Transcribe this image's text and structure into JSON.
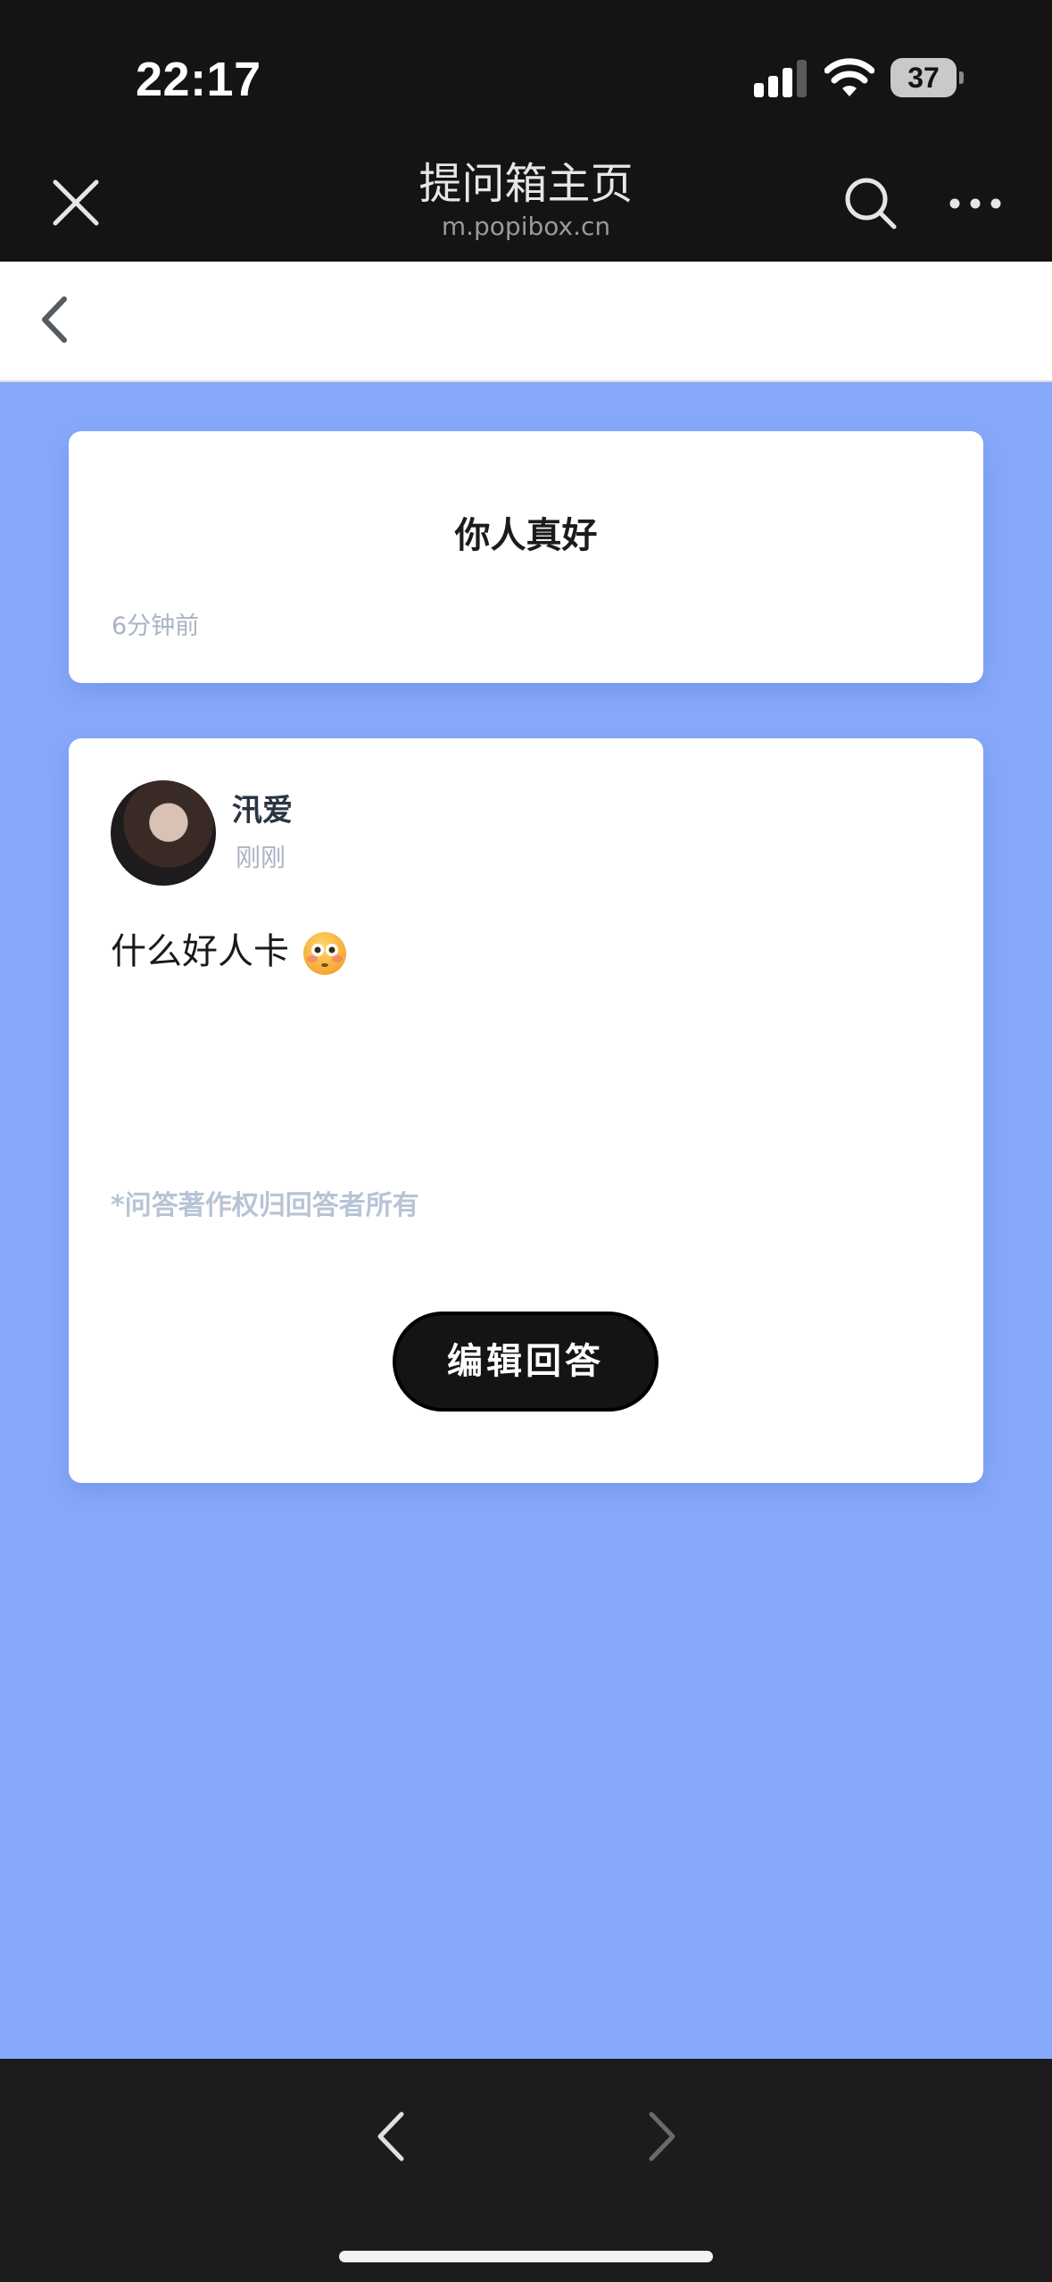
{
  "status_bar": {
    "time": "22:17",
    "battery_level": "37",
    "icons": [
      "signal-icon",
      "wifi-icon",
      "battery-icon"
    ]
  },
  "browser_header": {
    "title": "提问箱主页",
    "url": "m.popibox.cn",
    "icons": [
      "close-icon",
      "search-icon",
      "more-icon"
    ]
  },
  "nav": {
    "icons": [
      "back-chevron-icon"
    ]
  },
  "question": {
    "text": "你人真好",
    "time": "6分钟前"
  },
  "answer": {
    "user_name": "汛爱",
    "time": "刚刚",
    "text": "什么好人卡",
    "emoji": "flushed-face-emoji",
    "copyright": "*问答著作权归回答者所有",
    "edit_label": "编辑回答"
  },
  "bottom_toolbar": {
    "icons": [
      "back-arrow-icon",
      "forward-arrow-icon"
    ]
  },
  "colors": {
    "page_background": "#87a9fb",
    "header_background": "#141414",
    "card_background": "#ffffff",
    "muted_text": "#a9b3c4",
    "button_background": "#141414"
  }
}
